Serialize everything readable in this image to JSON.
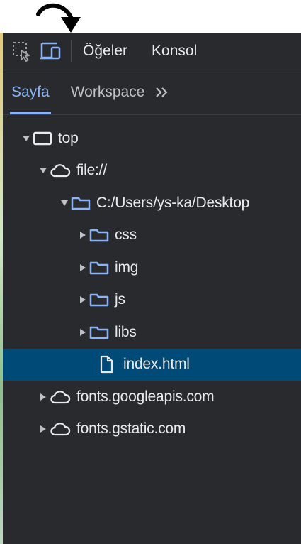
{
  "toolbar": {
    "inspect_icon": "inspect-element-icon",
    "device_icon": "device-toolbar-icon",
    "tabs": [
      "Öğeler",
      "Konsol"
    ]
  },
  "subtabs": {
    "active": "Sayfa",
    "second": "Workspace",
    "more_icon": "double-chevron-right-icon"
  },
  "tree": {
    "top": "top",
    "file_origin": "file://",
    "desktop_folder": "C:/Users/ys-ka/Desktop",
    "folders": [
      "css",
      "img",
      "js",
      "libs"
    ],
    "selected_file": "index.html",
    "origins": [
      "fonts.googleapis.com",
      "fonts.gstatic.com"
    ]
  },
  "colors": {
    "panel_bg": "#292a2d",
    "accent": "#8ab4f8",
    "selection_bg": "#004a77",
    "text": "#e8eaed"
  }
}
